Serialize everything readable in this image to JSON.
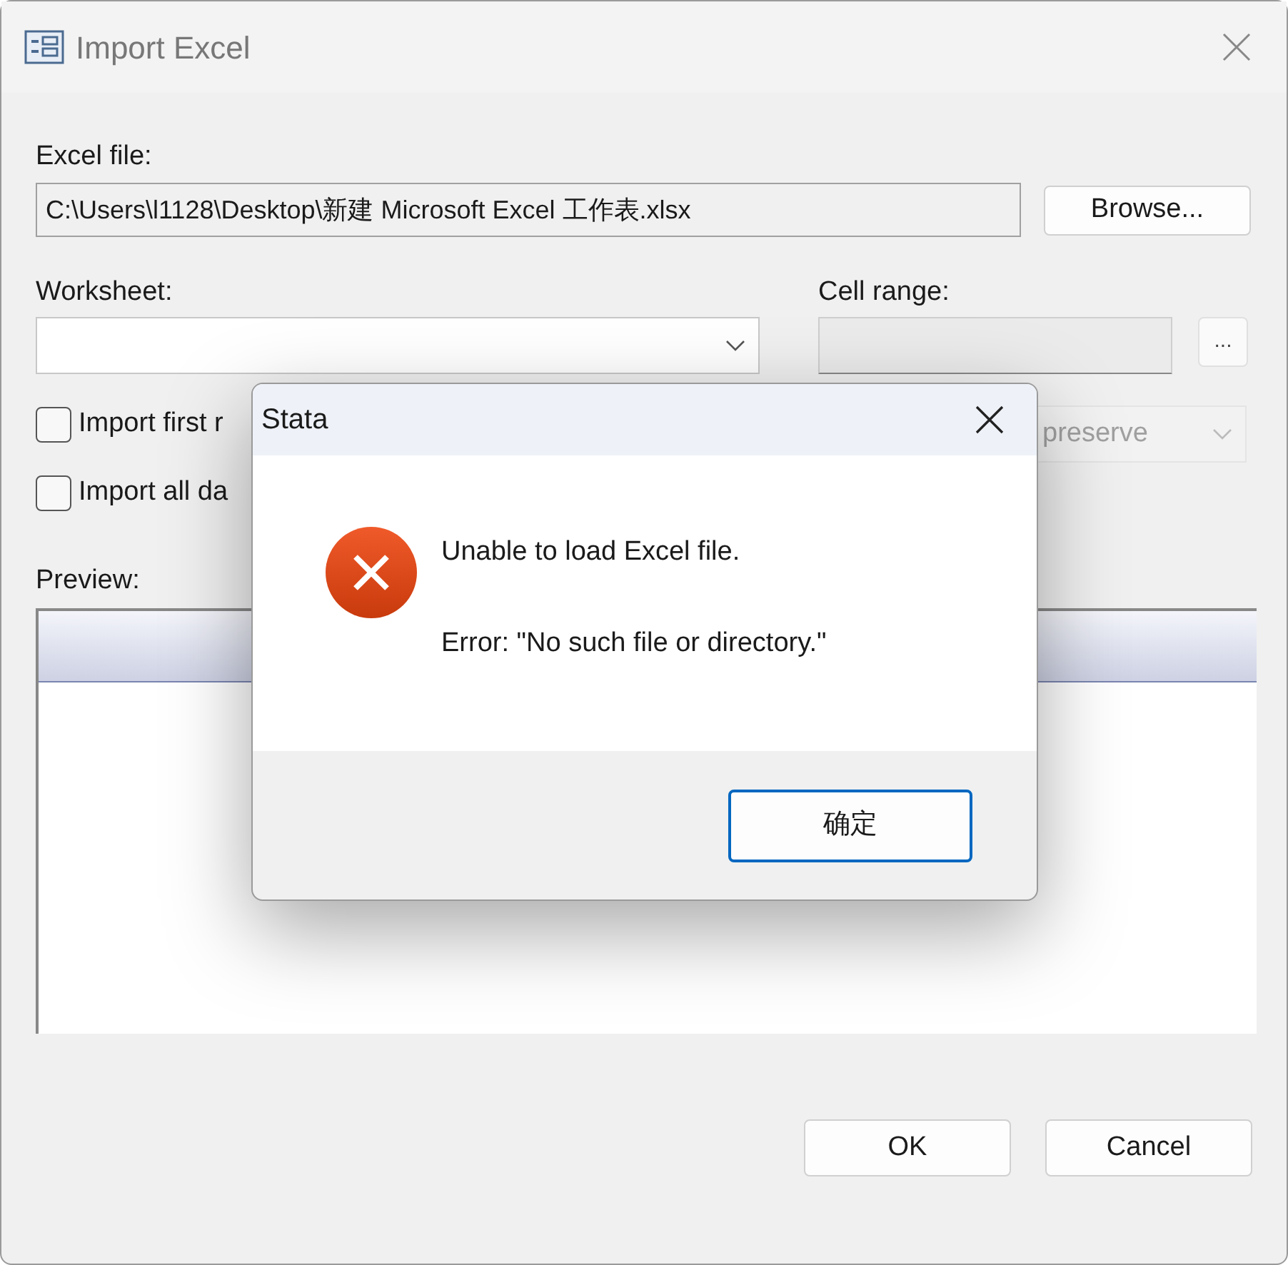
{
  "window": {
    "title": "Import Excel"
  },
  "excel_file": {
    "label": "Excel file:",
    "value": "C:\\Users\\l1128\\Desktop\\新建 Microsoft Excel 工作表.xlsx",
    "browse": "Browse..."
  },
  "worksheet": {
    "label": "Worksheet:"
  },
  "cell_range": {
    "label": "Cell range:",
    "button": "..."
  },
  "checkboxes": [
    {
      "label": "Import first r",
      "checked": false
    },
    {
      "label": "Import all da",
      "checked": false
    }
  ],
  "case_dropdown": {
    "value": "preserve",
    "disabled": true
  },
  "preview": {
    "label": "Preview:"
  },
  "alert": {
    "title": "Stata",
    "message": "Unable to load Excel file.",
    "detail": "Error: \"No such file or directory.\"",
    "button": "确定"
  },
  "buttons": [
    "OK",
    "Cancel"
  ]
}
